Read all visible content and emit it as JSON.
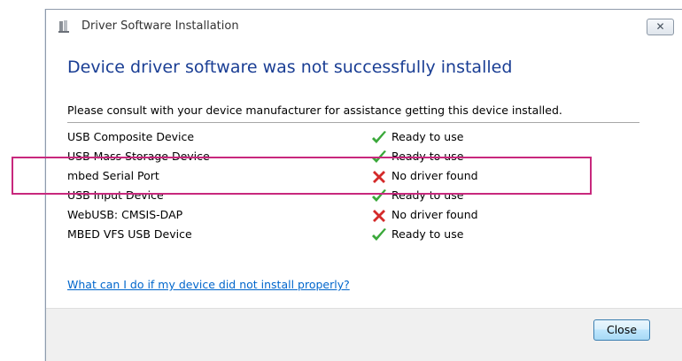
{
  "window": {
    "title": "Driver Software Installation",
    "close_glyph": "✕"
  },
  "heading": "Device driver software was not successfully installed",
  "message": "Please consult with your device manufacturer for assistance getting this device installed.",
  "devices": [
    {
      "name": "USB Composite Device",
      "status": "Ready to use",
      "state": "ok"
    },
    {
      "name": "USB Mass Storage Device",
      "status": "Ready to use",
      "state": "ok"
    },
    {
      "name": "mbed Serial Port",
      "status": "No driver found",
      "state": "error"
    },
    {
      "name": "USB Input Device",
      "status": "Ready to use",
      "state": "ok"
    },
    {
      "name": "WebUSB: CMSIS-DAP",
      "status": "No driver found",
      "state": "error"
    },
    {
      "name": "MBED VFS USB Device",
      "status": "Ready to use",
      "state": "ok"
    }
  ],
  "help_link": "What can I do if my device did not install properly?",
  "buttons": {
    "close_label": "Close"
  },
  "icons": {
    "ok": "green-checkmark-icon",
    "error": "red-x-icon"
  },
  "colors": {
    "heading": "#1a3e94",
    "link": "#0066cc",
    "highlight": "#c8287d",
    "ok": "#3aa83a",
    "error": "#d42a2a"
  }
}
